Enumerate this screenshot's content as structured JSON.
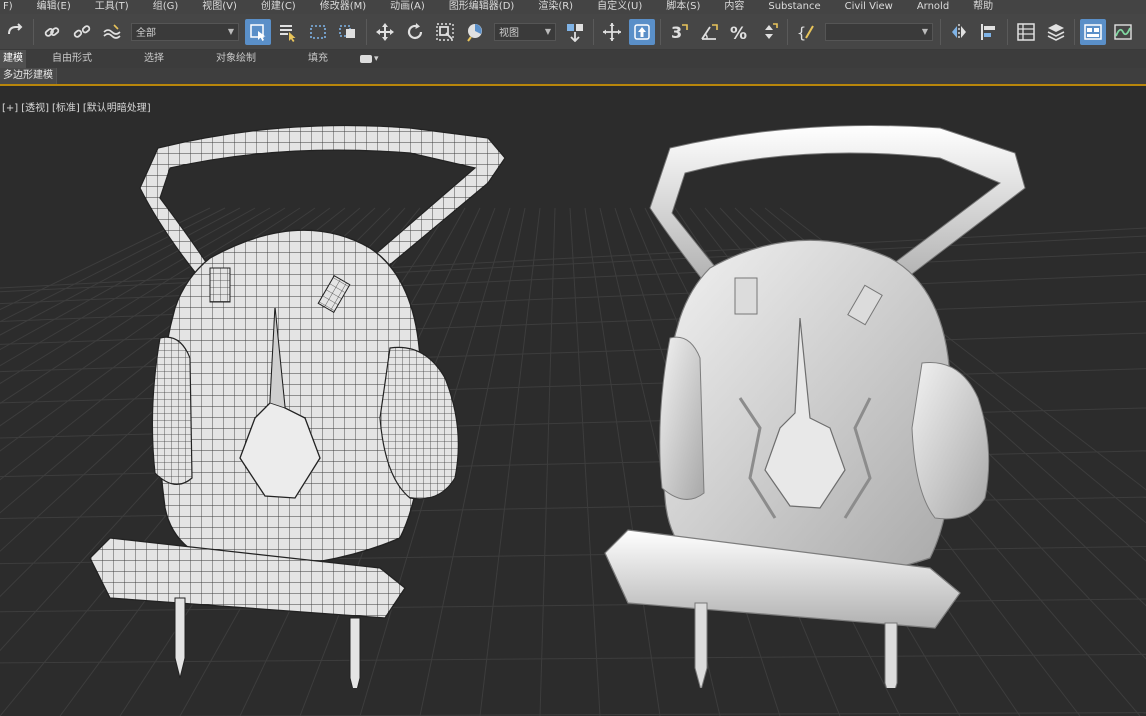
{
  "menubar": {
    "items": [
      "F)",
      "编辑(E)",
      "工具(T)",
      "组(G)",
      "视图(V)",
      "创建(C)",
      "修改器(M)",
      "动画(A)",
      "图形编辑器(D)",
      "渲染(R)",
      "自定义(U)",
      "脚本(S)",
      "内容",
      "Substance",
      "Civil View",
      "Arnold",
      "帮助"
    ]
  },
  "toolbar": {
    "selection_filter": "全部",
    "reference_coord": "视图",
    "named_selection": ""
  },
  "ribbon": {
    "tabs": [
      "建模",
      "自由形式",
      "选择",
      "对象绘制",
      "填充"
    ]
  },
  "subribbon": {
    "tab": "多边形建模"
  },
  "viewport": {
    "label_plus": "[+]",
    "label_view": "[透视]",
    "label_shading_std": "[标准]",
    "label_shading": "[默认明暗处理]"
  },
  "colors": {
    "menubar_bg": "#444444",
    "toolbar_bg": "#464646",
    "active_button": "#5a8fc8",
    "viewport_bg": "#2c2c2c",
    "grid_line": "#3d3d3d",
    "model_fill": "#d9d9d9",
    "wire_line": "#333333"
  },
  "icons": [
    "undo-icon",
    "link-icon",
    "unlink-icon",
    "bind-space-warp-icon",
    "select-object-icon",
    "select-by-name-icon",
    "rect-selection-region-icon",
    "window-crossing-icon",
    "move-icon",
    "rotate-icon",
    "scale-icon",
    "placement-icon",
    "pivot-center-icon",
    "key-mode-icon",
    "snap-3d-icon",
    "angle-snap-icon",
    "percent-snap-icon",
    "spinner-snap-icon",
    "edit-named-selection-icon",
    "mirror-icon",
    "align-icon",
    "scene-explorer-icon",
    "layer-explorer-icon",
    "ribbon-toggle-icon",
    "curve-editor-icon",
    "schematic-view-icon",
    "render-setup-icon"
  ]
}
